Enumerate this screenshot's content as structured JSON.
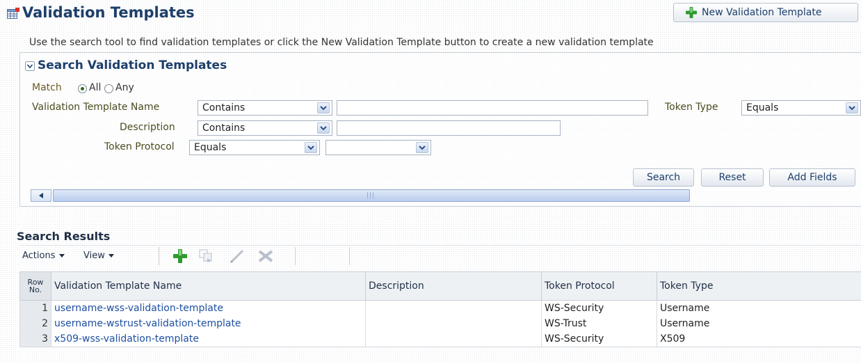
{
  "header": {
    "title": "Validation Templates",
    "new_button_label": "New Validation Template",
    "instructions": "Use the search tool to find validation templates or click the New Validation Template button to create a new validation template"
  },
  "search": {
    "heading": "Search Validation Templates",
    "match_label": "Match",
    "match_all": "All",
    "match_any": "Any",
    "match_selected": "All",
    "fields": {
      "name": {
        "label": "Validation Template Name",
        "operator": "Contains",
        "value": ""
      },
      "token_type": {
        "label": "Token Type",
        "operator": "Equals"
      },
      "description": {
        "label": "Description",
        "operator": "Contains",
        "value": ""
      },
      "token_protocol": {
        "label": "Token Protocol",
        "operator": "Equals",
        "value": ""
      }
    },
    "buttons": {
      "search": "Search",
      "reset": "Reset",
      "add_fields": "Add Fields"
    }
  },
  "results": {
    "heading": "Search Results",
    "toolbar": {
      "actions": "Actions",
      "view": "View"
    },
    "columns": {
      "row_no_line1": "Row",
      "row_no_line2": "No.",
      "name": "Validation Template Name",
      "description": "Description",
      "protocol": "Token Protocol",
      "type": "Token Type"
    },
    "rows": [
      {
        "no": "1",
        "name": "username-wss-validation-template",
        "description": "",
        "protocol": "WS-Security",
        "type": "Username"
      },
      {
        "no": "2",
        "name": "username-wstrust-validation-template",
        "description": "",
        "protocol": "WS-Trust",
        "type": "Username"
      },
      {
        "no": "3",
        "name": "x509-wss-validation-template",
        "description": "",
        "protocol": "WS-Security",
        "type": "X509"
      }
    ]
  },
  "colors": {
    "title": "#1d3f6b",
    "link": "#1d4fa0",
    "label": "#4b4b20",
    "add_icon": "#2e9a2e"
  },
  "icons": [
    "table-icon",
    "add-icon",
    "disclose-icon",
    "dropdown-arrow-icon",
    "duplicate-icon",
    "edit-icon",
    "delete-icon",
    "scroll-left-icon"
  ]
}
